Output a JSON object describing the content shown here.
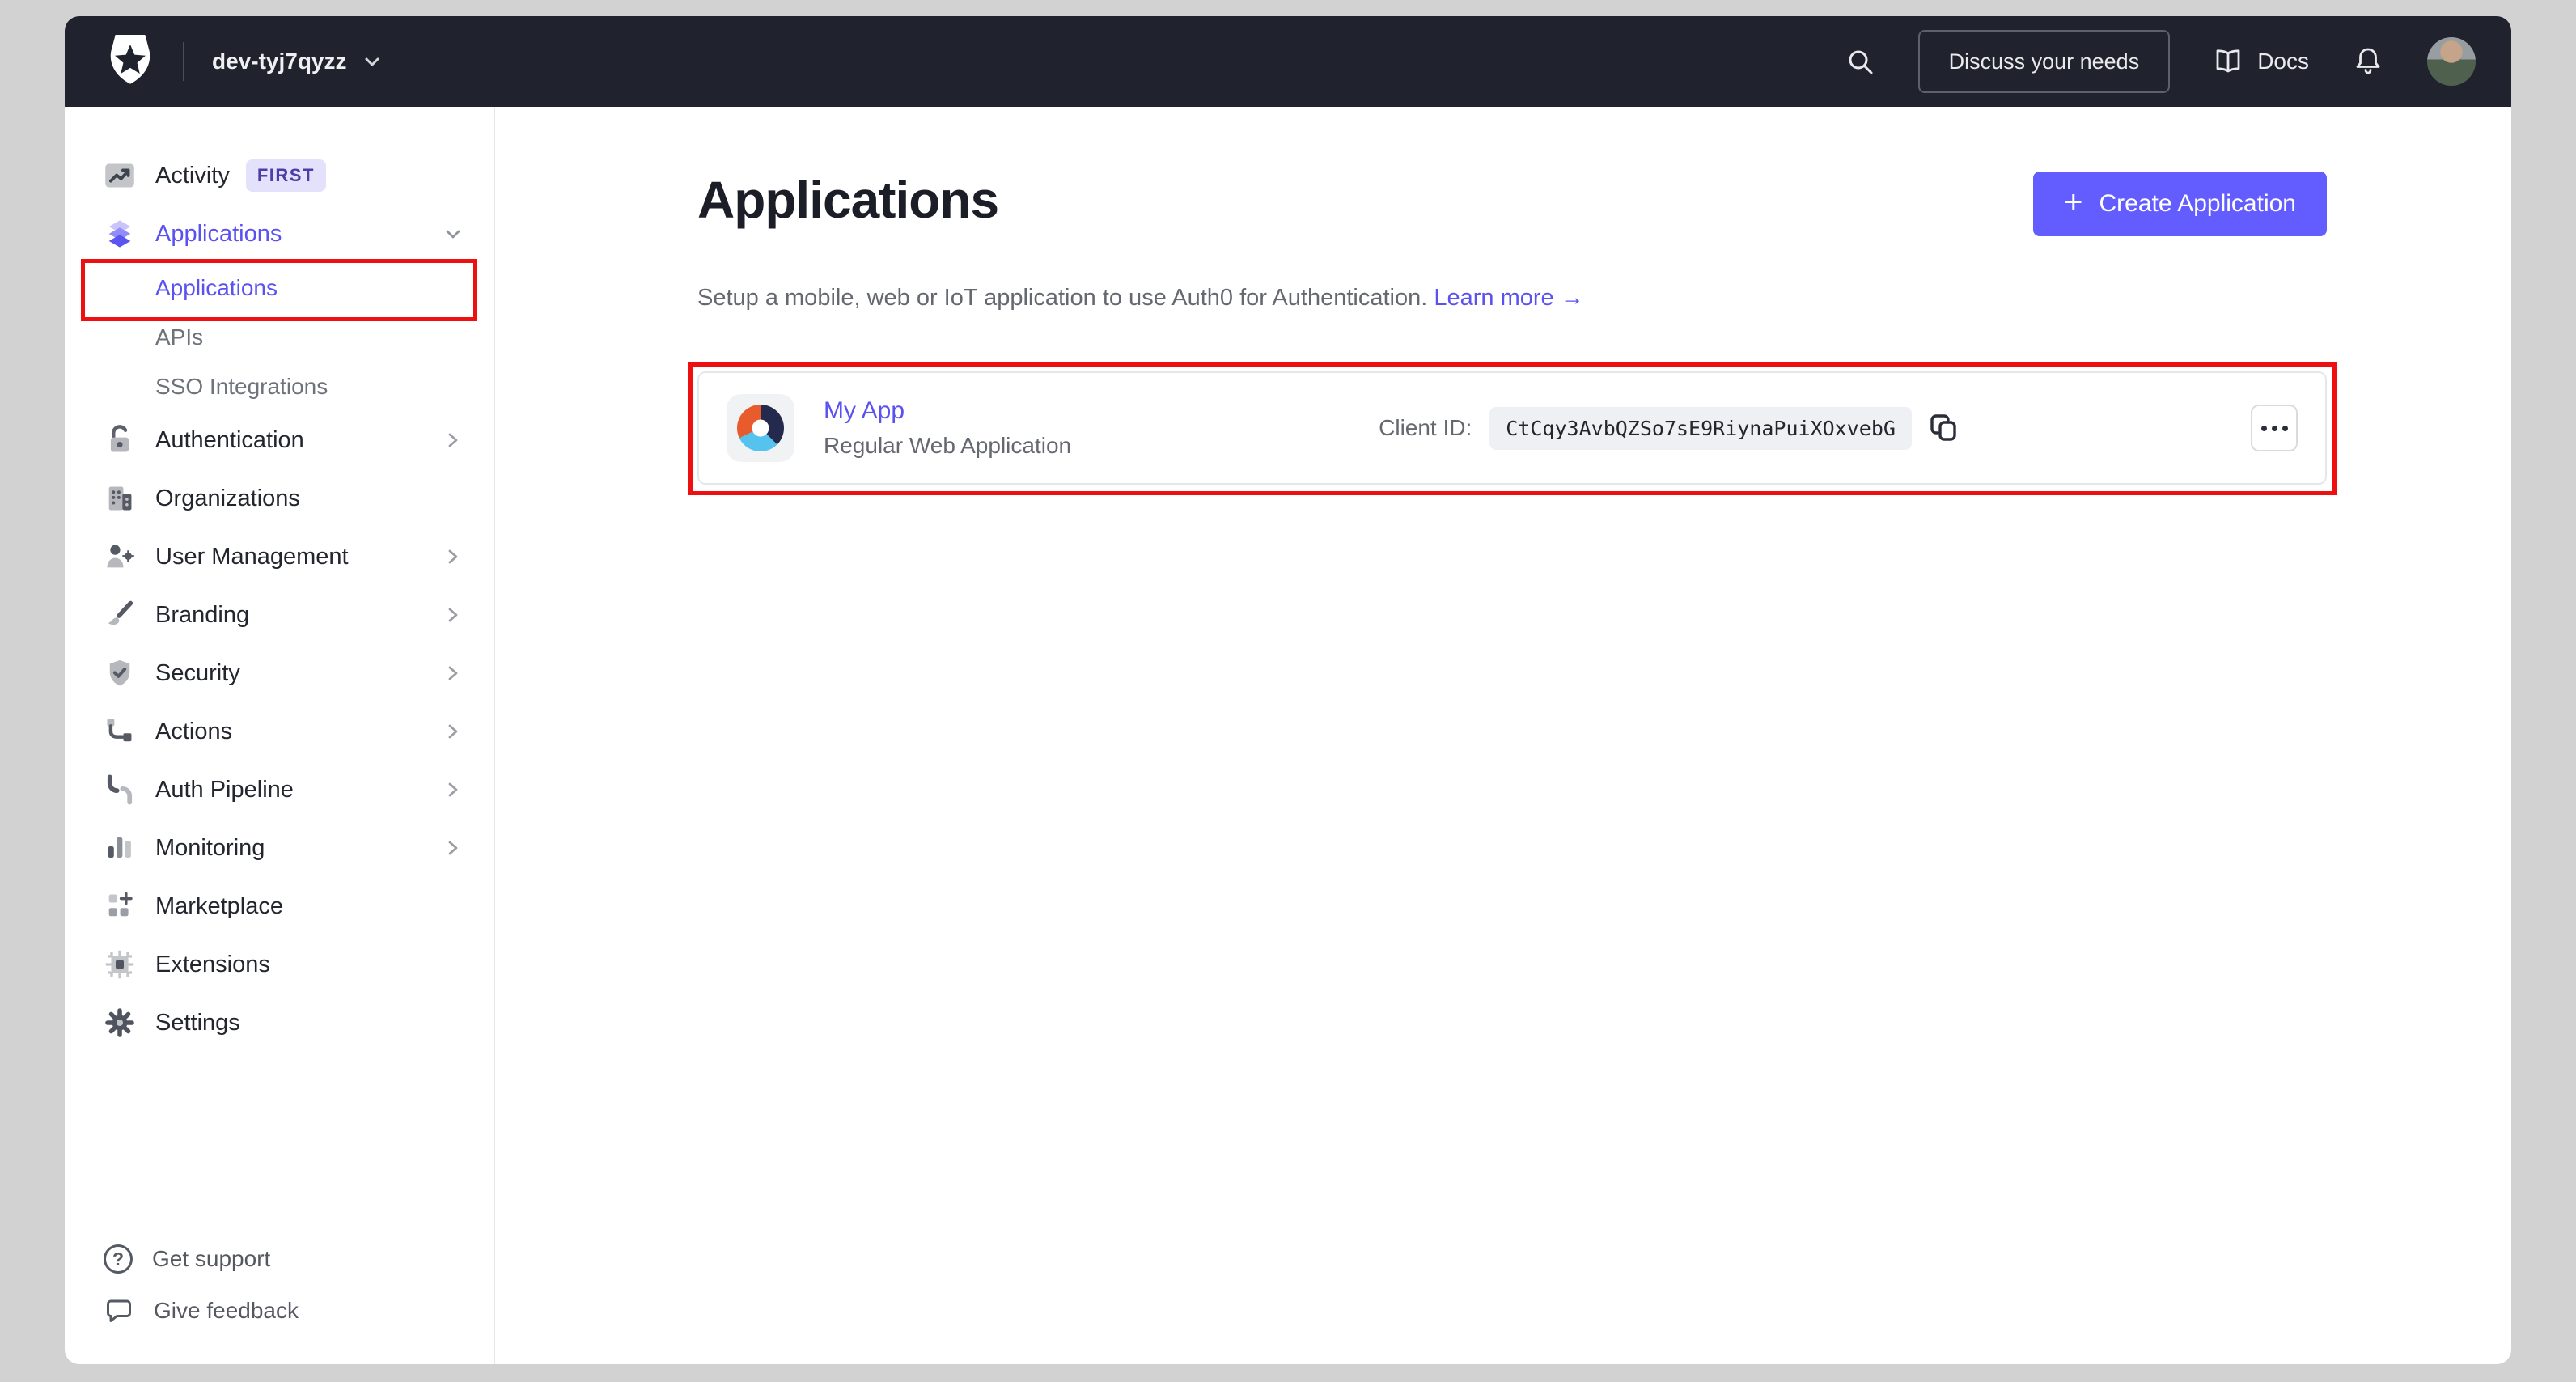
{
  "topbar": {
    "tenant": "dev-tyj7qyzz",
    "discuss_button": "Discuss your needs",
    "docs_label": "Docs"
  },
  "sidebar": {
    "items": [
      {
        "label": "Activity",
        "badge": "FIRST",
        "icon": "activity-icon"
      },
      {
        "label": "Applications",
        "icon": "layers-icon",
        "expanded": true,
        "active": true
      },
      {
        "label": "Authentication",
        "icon": "lock-icon",
        "has_chevron": true
      },
      {
        "label": "Organizations",
        "icon": "building-icon"
      },
      {
        "label": "User Management",
        "icon": "user-gear-icon",
        "has_chevron": true
      },
      {
        "label": "Branding",
        "icon": "paintbrush-icon",
        "has_chevron": true
      },
      {
        "label": "Security",
        "icon": "shield-check-icon",
        "has_chevron": true
      },
      {
        "label": "Actions",
        "icon": "flow-icon",
        "has_chevron": true
      },
      {
        "label": "Auth Pipeline",
        "icon": "pipeline-icon",
        "has_chevron": true
      },
      {
        "label": "Monitoring",
        "icon": "bar-chart-icon",
        "has_chevron": true
      },
      {
        "label": "Marketplace",
        "icon": "grid-plus-icon"
      },
      {
        "label": "Extensions",
        "icon": "chip-icon"
      },
      {
        "label": "Settings",
        "icon": "gear-icon"
      }
    ],
    "sub_items": [
      {
        "label": "Applications",
        "active": true,
        "annotated": true
      },
      {
        "label": "APIs"
      },
      {
        "label": "SSO Integrations"
      }
    ],
    "footer_items": [
      {
        "label": "Get support",
        "icon": "help-icon",
        "glyph": "?"
      },
      {
        "label": "Give feedback",
        "icon": "speech-bubble-icon"
      }
    ]
  },
  "main": {
    "title": "Applications",
    "description": "Setup a mobile, web or IoT application to use Auth0 for Authentication.",
    "learn_more": "Learn more",
    "arrow": "→",
    "create_button": "Create Application",
    "create_plus": "+",
    "application": {
      "name": "My App",
      "type": "Regular Web Application",
      "client_id_label": "Client ID:",
      "client_id": "CtCqy3AvbQZSo7sE9RiynaPuiXOxvebG"
    }
  },
  "annotations": {
    "color": "#ee1010",
    "boxes": [
      "sidebar-applications-subitem",
      "application-row"
    ]
  },
  "colors": {
    "accent": "#635dff",
    "link": "#5a51f0",
    "topbar_bg": "#20232d",
    "outer_bg": "#d2d2d2",
    "badge_bg": "#e4e1fd",
    "badge_text": "#4b3fa5"
  }
}
